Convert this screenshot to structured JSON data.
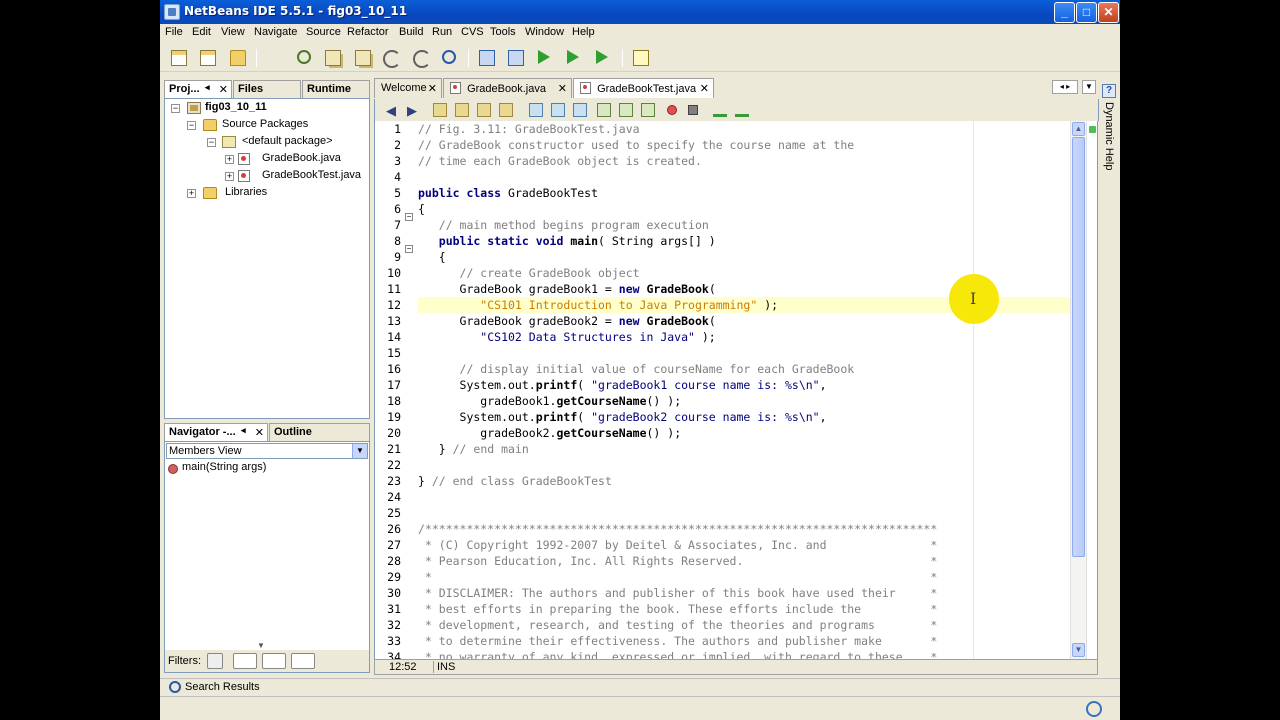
{
  "window": {
    "title": "NetBeans IDE 5.5.1 - fig03_10_11",
    "minimize": "_",
    "maximize": "□",
    "close": "✕"
  },
  "menu": [
    "File",
    "Edit",
    "View",
    "Navigate",
    "Source",
    "Refactor",
    "Build",
    "Run",
    "CVS",
    "Tools",
    "Window",
    "Help"
  ],
  "toolbar_icons": [
    "new-file-icon",
    "new-project-icon",
    "open-project-icon",
    "cut-icon",
    "copy-icon",
    "paste-icon",
    "undo-icon",
    "redo-icon",
    "find-icon",
    "build-icon",
    "clean-build-icon",
    "run-icon",
    "run-file-icon",
    "debug-icon",
    "help-icon"
  ],
  "projects_panel": {
    "tabs": [
      "Proj...",
      "Files",
      "Runtime"
    ],
    "close": "✕",
    "tree": [
      {
        "label": "fig03_10_11",
        "bold": true
      },
      {
        "label": "Source Packages"
      },
      {
        "label": "<default package>"
      },
      {
        "label": "GradeBook.java"
      },
      {
        "label": "GradeBookTest.java"
      },
      {
        "label": "Libraries"
      }
    ]
  },
  "navigator_panel": {
    "tabs": [
      "Navigator -...",
      "Outline"
    ],
    "close": "✕",
    "view_select": "Members View",
    "members": [
      "main(String args)"
    ],
    "filters_label": "Filters:"
  },
  "editor": {
    "tabs": [
      {
        "label": "Welcome"
      },
      {
        "label": "GradeBook.java"
      },
      {
        "label": "GradeBookTest.java"
      }
    ],
    "close": "✕",
    "line_numbers": [
      "1",
      "2",
      "3",
      "4",
      "5",
      "6",
      "7",
      "8",
      "9",
      "10",
      "11",
      "12",
      "13",
      "14",
      "15",
      "16",
      "17",
      "18",
      "19",
      "20",
      "21",
      "22",
      "23",
      "24",
      "25",
      "26",
      "27",
      "28",
      "29",
      "30",
      "31",
      "32",
      "33",
      "34"
    ],
    "lines": [
      [
        {
          "t": "cm",
          "s": "// Fig. 3.11: GradeBookTest.java"
        }
      ],
      [
        {
          "t": "cm",
          "s": "// GradeBook constructor used to specify the course name at the"
        }
      ],
      [
        {
          "t": "cm",
          "s": "// time each GradeBook object is created."
        }
      ],
      [],
      [
        {
          "t": "kw",
          "s": "public class "
        },
        {
          "t": "tx",
          "s": "GradeBookTest"
        }
      ],
      [
        {
          "t": "tx",
          "s": "{"
        }
      ],
      [
        {
          "t": "cm",
          "s": "   // main method begins program execution"
        }
      ],
      [
        {
          "t": "kw",
          "s": "   public static void "
        },
        {
          "t": "bd",
          "s": "main"
        },
        {
          "t": "tx",
          "s": "( String args[] )"
        }
      ],
      [
        {
          "t": "tx",
          "s": "   {"
        }
      ],
      [
        {
          "t": "cm",
          "s": "      // create GradeBook object"
        }
      ],
      [
        {
          "t": "tx",
          "s": "      GradeBook gradeBook1 = "
        },
        {
          "t": "kw",
          "s": "new "
        },
        {
          "t": "bd",
          "s": "GradeBook"
        },
        {
          "t": "tx",
          "s": "("
        }
      ],
      [
        {
          "t": "st",
          "s": "         \"CS101 Introduction to Java Programming\""
        },
        {
          "t": "tx",
          "s": " );"
        }
      ],
      [
        {
          "t": "tx",
          "s": "      GradeBook gradeBook2 = "
        },
        {
          "t": "kw",
          "s": "new "
        },
        {
          "t": "bd",
          "s": "GradeBook"
        },
        {
          "t": "tx",
          "s": "("
        }
      ],
      [
        {
          "t": "st2",
          "s": "         \"CS102 Data Structures in Java\""
        },
        {
          "t": "tx",
          "s": " );"
        }
      ],
      [],
      [
        {
          "t": "cm",
          "s": "      // display initial value of courseName for each GradeBook"
        }
      ],
      [
        {
          "t": "tx",
          "s": "      System.out."
        },
        {
          "t": "bd",
          "s": "printf"
        },
        {
          "t": "tx",
          "s": "( "
        },
        {
          "t": "st2",
          "s": "\"gradeBook1 course name is: %s\\n\""
        },
        {
          "t": "tx",
          "s": ","
        }
      ],
      [
        {
          "t": "tx",
          "s": "         gradeBook1."
        },
        {
          "t": "bd",
          "s": "getCourseName"
        },
        {
          "t": "tx",
          "s": "() );"
        }
      ],
      [
        {
          "t": "tx",
          "s": "      System.out."
        },
        {
          "t": "bd",
          "s": "printf"
        },
        {
          "t": "tx",
          "s": "( "
        },
        {
          "t": "st2",
          "s": "\"gradeBook2 course name is: %s\\n\""
        },
        {
          "t": "tx",
          "s": ","
        }
      ],
      [
        {
          "t": "tx",
          "s": "         gradeBook2."
        },
        {
          "t": "bd",
          "s": "getCourseName"
        },
        {
          "t": "tx",
          "s": "() );"
        }
      ],
      [
        {
          "t": "tx",
          "s": "   } "
        },
        {
          "t": "cm",
          "s": "// end main"
        }
      ],
      [],
      [
        {
          "t": "tx",
          "s": "} "
        },
        {
          "t": "cm",
          "s": "// end class GradeBookTest"
        }
      ],
      [],
      [],
      [
        {
          "t": "cm",
          "s": "/**************************************************************************"
        }
      ],
      [
        {
          "t": "cm",
          "s": " * (C) Copyright 1992-2007 by Deitel & Associates, Inc. and               *"
        }
      ],
      [
        {
          "t": "cm",
          "s": " * Pearson Education, Inc. All Rights Reserved.                           *"
        }
      ],
      [
        {
          "t": "cm",
          "s": " *                                                                        *"
        }
      ],
      [
        {
          "t": "cm",
          "s": " * DISCLAIMER: The authors and publisher of this book have used their     *"
        }
      ],
      [
        {
          "t": "cm",
          "s": " * best efforts in preparing the book. These efforts include the          *"
        }
      ],
      [
        {
          "t": "cm",
          "s": " * development, research, and testing of the theories and programs        *"
        }
      ],
      [
        {
          "t": "cm",
          "s": " * to determine their effectiveness. The authors and publisher make       *"
        }
      ],
      [
        {
          "t": "cm",
          "s": " * no warranty of any kind, expressed or implied, with regard to these    *"
        }
      ]
    ],
    "status_position": "12:52",
    "status_mode": "INS"
  },
  "right_panel": {
    "label": "Dynamic Help",
    "icon": "?"
  },
  "bottom": {
    "search_results": "Search Results"
  }
}
